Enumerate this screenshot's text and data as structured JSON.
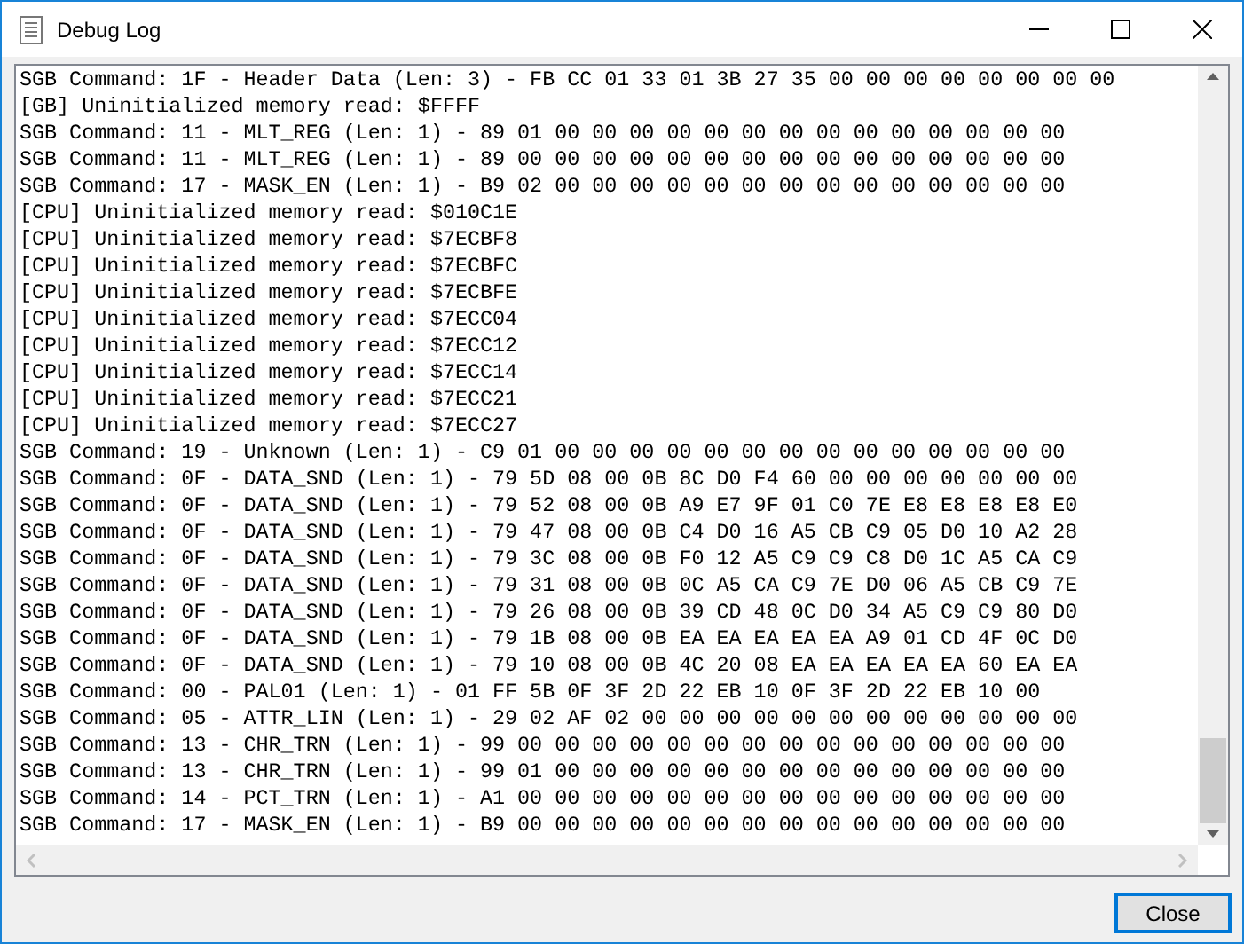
{
  "window": {
    "title": "Debug Log"
  },
  "log_lines": [
    "SGB Command: 1F - Header Data (Len: 3) - FB CC 01 33 01 3B 27 35 00 00 00 00 00 00 00 00",
    "[GB] Uninitialized memory read: $FFFF",
    "SGB Command: 11 - MLT_REG (Len: 1) - 89 01 00 00 00 00 00 00 00 00 00 00 00 00 00 00",
    "SGB Command: 11 - MLT_REG (Len: 1) - 89 00 00 00 00 00 00 00 00 00 00 00 00 00 00 00",
    "SGB Command: 17 - MASK_EN (Len: 1) - B9 02 00 00 00 00 00 00 00 00 00 00 00 00 00 00",
    "[CPU] Uninitialized memory read: $010C1E",
    "[CPU] Uninitialized memory read: $7ECBF8",
    "[CPU] Uninitialized memory read: $7ECBFC",
    "[CPU] Uninitialized memory read: $7ECBFE",
    "[CPU] Uninitialized memory read: $7ECC04",
    "[CPU] Uninitialized memory read: $7ECC12",
    "[CPU] Uninitialized memory read: $7ECC14",
    "[CPU] Uninitialized memory read: $7ECC21",
    "[CPU] Uninitialized memory read: $7ECC27",
    "SGB Command: 19 - Unknown (Len: 1) - C9 01 00 00 00 00 00 00 00 00 00 00 00 00 00 00",
    "SGB Command: 0F - DATA_SND (Len: 1) - 79 5D 08 00 0B 8C D0 F4 60 00 00 00 00 00 00 00",
    "SGB Command: 0F - DATA_SND (Len: 1) - 79 52 08 00 0B A9 E7 9F 01 C0 7E E8 E8 E8 E8 E0",
    "SGB Command: 0F - DATA_SND (Len: 1) - 79 47 08 00 0B C4 D0 16 A5 CB C9 05 D0 10 A2 28",
    "SGB Command: 0F - DATA_SND (Len: 1) - 79 3C 08 00 0B F0 12 A5 C9 C9 C8 D0 1C A5 CA C9",
    "SGB Command: 0F - DATA_SND (Len: 1) - 79 31 08 00 0B 0C A5 CA C9 7E D0 06 A5 CB C9 7E",
    "SGB Command: 0F - DATA_SND (Len: 1) - 79 26 08 00 0B 39 CD 48 0C D0 34 A5 C9 C9 80 D0",
    "SGB Command: 0F - DATA_SND (Len: 1) - 79 1B 08 00 0B EA EA EA EA EA A9 01 CD 4F 0C D0",
    "SGB Command: 0F - DATA_SND (Len: 1) - 79 10 08 00 0B 4C 20 08 EA EA EA EA EA 60 EA EA",
    "SGB Command: 00 - PAL01 (Len: 1) - 01 FF 5B 0F 3F 2D 22 EB 10 0F 3F 2D 22 EB 10 00",
    "SGB Command: 05 - ATTR_LIN (Len: 1) - 29 02 AF 02 00 00 00 00 00 00 00 00 00 00 00 00",
    "SGB Command: 13 - CHR_TRN (Len: 1) - 99 00 00 00 00 00 00 00 00 00 00 00 00 00 00 00",
    "SGB Command: 13 - CHR_TRN (Len: 1) - 99 01 00 00 00 00 00 00 00 00 00 00 00 00 00 00",
    "SGB Command: 14 - PCT_TRN (Len: 1) - A1 00 00 00 00 00 00 00 00 00 00 00 00 00 00 00",
    "SGB Command: 17 - MASK_EN (Len: 1) - B9 00 00 00 00 00 00 00 00 00 00 00 00 00 00 00"
  ],
  "buttons": [
    {
      "label": "Close"
    }
  ]
}
